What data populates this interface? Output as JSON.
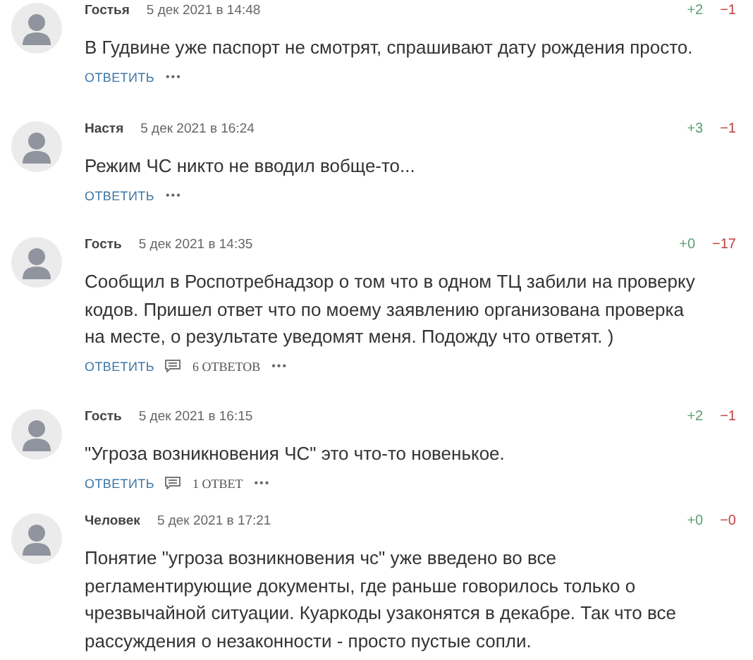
{
  "comments": [
    {
      "author": "Гостья",
      "date": "5 дек 2021 в 14:48",
      "plus": "+2",
      "minus": "−1",
      "text": "В Гудвине уже паспорт не смотрят, спрашивают дату рождения просто.",
      "reply": "ОТВЕТИТЬ",
      "more": "•••"
    },
    {
      "author": "Настя",
      "date": "5 дек 2021 в 16:24",
      "plus": "+3",
      "minus": "−1",
      "text": "Режим ЧС никто не вводил вобще-то...",
      "reply": "ОТВЕТИТЬ",
      "more": "•••"
    },
    {
      "author": "Гость",
      "date": "5 дек 2021 в 14:35",
      "plus": "+0",
      "minus": "−17",
      "text": "Сообщил в Роспотребнадзор о том что в одном ТЦ забили на проверку кодов. Пришел ответ что по моему заявлению организована проверка на месте, о результате уведомят меня. Подожду что ответят. )",
      "reply": "ОТВЕТИТЬ",
      "replies": "6 ОТВЕТОВ",
      "more": "•••"
    },
    {
      "author": "Гость",
      "date": "5 дек 2021 в 16:15",
      "plus": "+2",
      "minus": "−1",
      "text": "\"Угроза возникновения ЧС\" это что-то новенькое.",
      "reply": "ОТВЕТИТЬ",
      "replies": "1 ОТВЕТ",
      "more": "•••"
    },
    {
      "author": "Человек",
      "date": "5 дек 2021 в 17:21",
      "plus": "+0",
      "minus": "−0",
      "text": "Понятие \"угроза возникновения чс\" уже введено во все регламентирующие документы, где раньше говорилось только о чрезвычайной ситуации. Куаркоды узаконятся в декабре. Так что все рассуждения о незаконности - просто пустые сопли."
    }
  ]
}
